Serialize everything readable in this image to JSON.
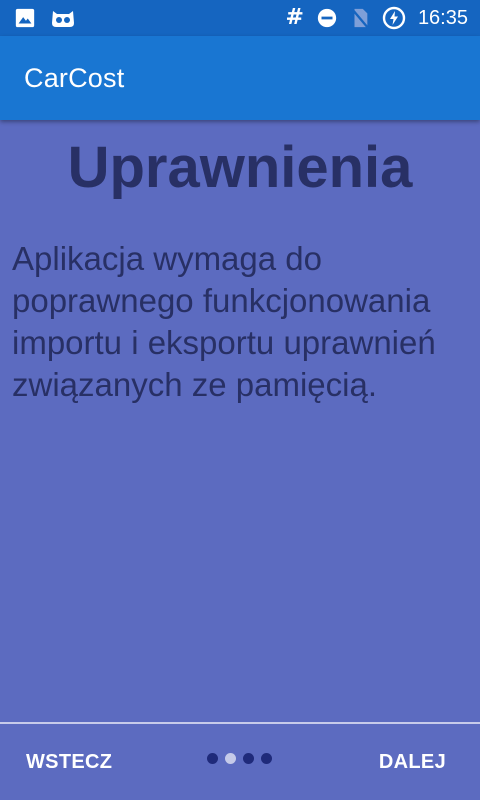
{
  "status_bar": {
    "time": "16:35",
    "hash_symbol": "#",
    "left_icons": [
      "image-icon",
      "robot-face-icon"
    ],
    "right_icons": [
      "hash-icon",
      "do-not-disturb-icon",
      "no-sim-icon",
      "battery-charging-icon"
    ]
  },
  "app_bar": {
    "title": "CarCost",
    "color": "#1976d2"
  },
  "main": {
    "title": "Uprawnienia",
    "description": "Aplikacja wymaga do poprawnego funkcjonowania importu i eksportu uprawnień związanych ze pamięcią.",
    "background": "#5c6bc0",
    "text_color": "#283065"
  },
  "nav": {
    "back_label": "WSTECZ",
    "next_label": "DALEJ",
    "page_count": 4,
    "current_page": 2
  }
}
